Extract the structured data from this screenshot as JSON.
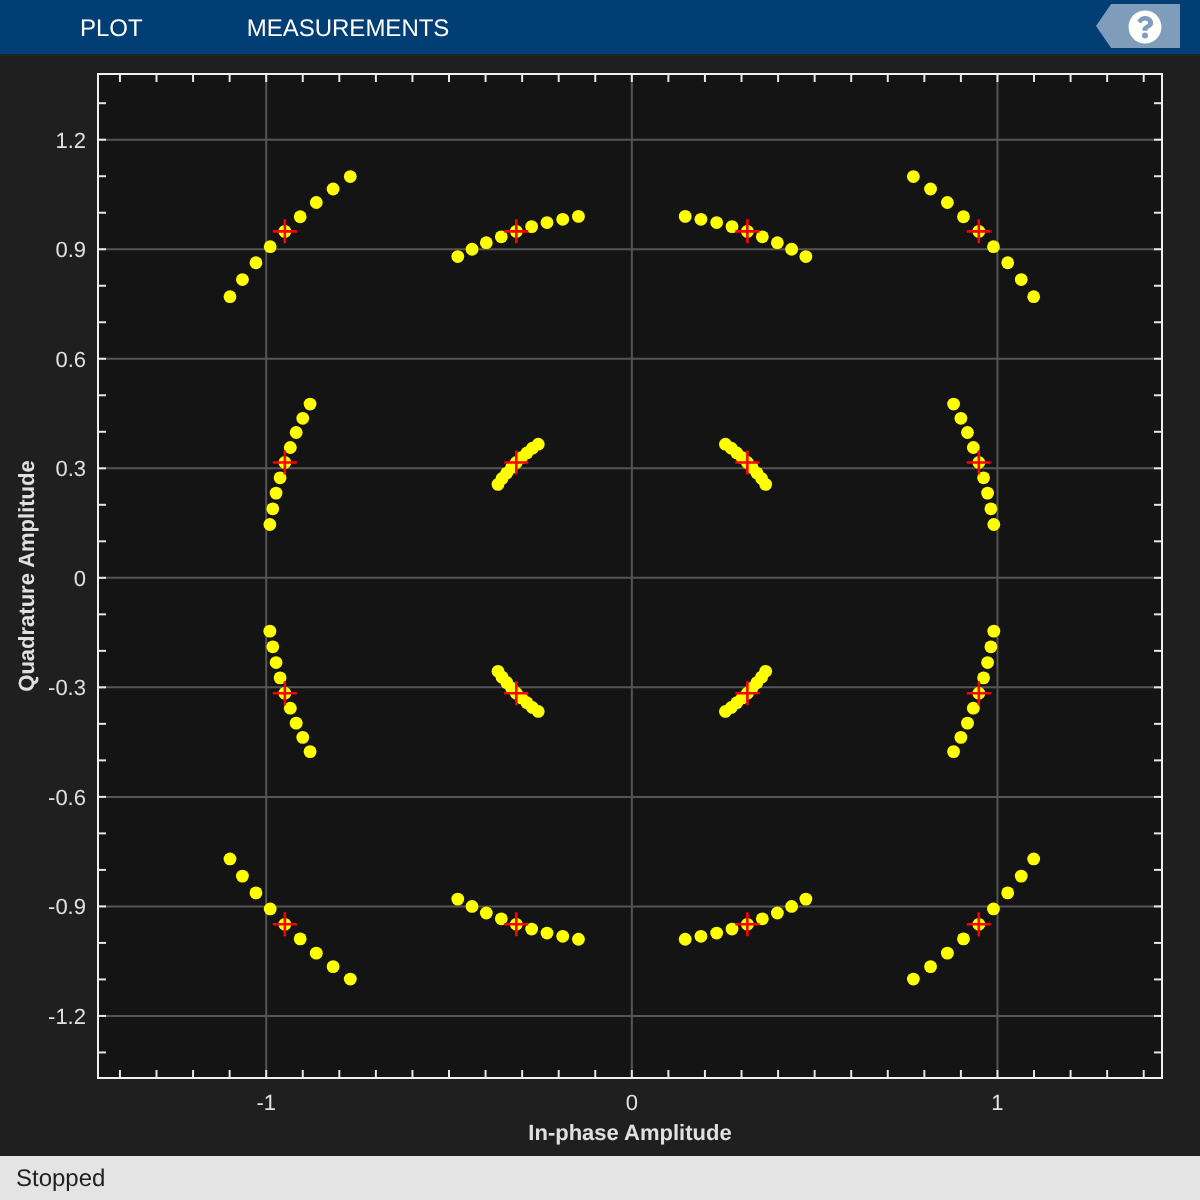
{
  "toolstrip": {
    "tabs": [
      "PLOT",
      "MEASUREMENTS"
    ]
  },
  "plot": {
    "chart_data": {
      "type": "scatter",
      "xlabel": "In-phase Amplitude",
      "ylabel": "Quadrature Amplitude",
      "xlim": [
        -1.46,
        1.45
      ],
      "ylim": [
        -1.37,
        1.38
      ],
      "xticks": [
        -1,
        0,
        1
      ],
      "yticks": [
        -1.2,
        -0.9,
        -0.6,
        -0.3,
        0,
        0.3,
        0.6,
        0.9,
        1.2
      ],
      "grid": true,
      "series": [
        {
          "color": "#ffff00",
          "x": [
            0.77,
            0.817,
            0.863,
            0.907,
            0.949,
            0.989,
            1.028,
            1.065,
            1.099,
            0.88,
            0.9,
            0.918,
            0.934,
            0.949,
            0.962,
            0.973,
            0.982,
            0.99,
            0.476,
            0.437,
            0.398,
            0.357,
            0.316,
            0.274,
            0.232,
            0.189,
            0.146,
            0.256,
            0.272,
            0.287,
            0.302,
            0.316,
            0.329,
            0.342,
            0.355,
            0.366,
            -0.77,
            -0.817,
            -0.863,
            -0.907,
            -0.949,
            -0.989,
            -1.028,
            -1.065,
            -1.099,
            -0.88,
            -0.9,
            -0.918,
            -0.934,
            -0.949,
            -0.962,
            -0.973,
            -0.982,
            -0.99,
            -0.476,
            -0.437,
            -0.398,
            -0.357,
            -0.316,
            -0.274,
            -0.232,
            -0.189,
            -0.146,
            -0.256,
            -0.272,
            -0.287,
            -0.302,
            -0.316,
            -0.329,
            -0.342,
            -0.355,
            -0.366,
            -0.77,
            -0.817,
            -0.863,
            -0.907,
            -0.949,
            -0.989,
            -1.028,
            -1.065,
            -1.099,
            -0.88,
            -0.9,
            -0.918,
            -0.934,
            -0.949,
            -0.962,
            -0.973,
            -0.982,
            -0.99,
            -0.476,
            -0.437,
            -0.398,
            -0.357,
            -0.316,
            -0.274,
            -0.232,
            -0.189,
            -0.146,
            -0.256,
            -0.272,
            -0.287,
            -0.302,
            -0.316,
            -0.329,
            -0.342,
            -0.355,
            -0.366,
            0.77,
            0.817,
            0.863,
            0.907,
            0.949,
            0.989,
            1.028,
            1.065,
            1.099,
            0.88,
            0.9,
            0.918,
            0.934,
            0.949,
            0.962,
            0.973,
            0.982,
            0.99,
            0.476,
            0.437,
            0.398,
            0.357,
            0.316,
            0.274,
            0.232,
            0.189,
            0.146,
            0.256,
            0.272,
            0.287,
            0.302,
            0.316,
            0.329,
            0.342,
            0.355,
            0.366
          ],
          "values": [
            1.099,
            1.065,
            1.028,
            0.989,
            0.949,
            0.907,
            0.863,
            0.817,
            0.77,
            0.476,
            0.437,
            0.398,
            0.357,
            0.316,
            0.274,
            0.232,
            0.189,
            0.146,
            0.88,
            0.9,
            0.918,
            0.934,
            0.949,
            0.962,
            0.973,
            0.982,
            0.99,
            0.366,
            0.355,
            0.342,
            0.329,
            0.316,
            0.302,
            0.287,
            0.272,
            0.256,
            1.099,
            1.065,
            1.028,
            0.989,
            0.949,
            0.907,
            0.863,
            0.817,
            0.77,
            0.476,
            0.437,
            0.398,
            0.357,
            0.316,
            0.274,
            0.232,
            0.189,
            0.146,
            0.88,
            0.9,
            0.918,
            0.934,
            0.949,
            0.962,
            0.973,
            0.982,
            0.99,
            0.366,
            0.355,
            0.342,
            0.329,
            0.316,
            0.302,
            0.287,
            0.272,
            0.256,
            -1.099,
            -1.065,
            -1.028,
            -0.989,
            -0.949,
            -0.907,
            -0.863,
            -0.817,
            -0.77,
            -0.476,
            -0.437,
            -0.398,
            -0.357,
            -0.316,
            -0.274,
            -0.232,
            -0.189,
            -0.146,
            -0.88,
            -0.9,
            -0.918,
            -0.934,
            -0.949,
            -0.962,
            -0.973,
            -0.982,
            -0.99,
            -0.366,
            -0.355,
            -0.342,
            -0.329,
            -0.316,
            -0.302,
            -0.287,
            -0.272,
            -0.256,
            -1.099,
            -1.065,
            -1.028,
            -0.989,
            -0.949,
            -0.907,
            -0.863,
            -0.817,
            -0.77,
            -0.476,
            -0.437,
            -0.398,
            -0.357,
            -0.316,
            -0.274,
            -0.232,
            -0.189,
            -0.146,
            -0.88,
            -0.9,
            -0.918,
            -0.934,
            -0.949,
            -0.962,
            -0.973,
            -0.982,
            -0.99,
            -0.366,
            -0.355,
            -0.342,
            -0.329,
            -0.316,
            -0.302,
            -0.287,
            -0.272,
            -0.256
          ]
        },
        {
          "color": "#ff0000",
          "x": [
            -0.949,
            -0.949,
            -0.949,
            -0.949,
            -0.316,
            -0.316,
            -0.316,
            -0.316,
            0.316,
            0.316,
            0.316,
            0.316,
            0.949,
            0.949,
            0.949,
            0.949
          ],
          "values": [
            -0.949,
            -0.316,
            0.316,
            0.949,
            -0.949,
            -0.316,
            0.316,
            0.949,
            -0.949,
            -0.316,
            0.316,
            0.949,
            -0.949,
            -0.316,
            0.316,
            0.949
          ]
        }
      ]
    }
  },
  "status_bar": {
    "text": "Stopped"
  }
}
